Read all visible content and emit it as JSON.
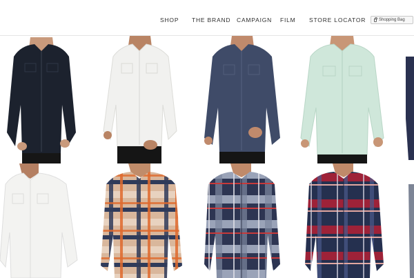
{
  "header": {
    "nav": [
      "SHOP",
      "THE BRAND",
      "CAMPAIGN",
      "FILM",
      "STORE LOCATOR"
    ],
    "bag_label": "Shopping Bag"
  },
  "colors": {
    "nav_text": "#2e2e2e",
    "background": "#ffffff"
  },
  "products": [
    {
      "style": "navy solid denim western shirt",
      "color": "#1c222e"
    },
    {
      "style": "white solid western shirt",
      "color": "#f1f1ef"
    },
    {
      "style": "slate blue solid western shirt",
      "color": "#3f4b68"
    },
    {
      "style": "mint solid western shirt",
      "color": "#cfe7da"
    },
    {
      "style": "white solid shirt",
      "color": "#f3f3f1"
    },
    {
      "style": "tan orange navy plaid shirt",
      "color": "#c89a7a"
    },
    {
      "style": "navy grey red plaid shirt",
      "color": "#2d3552"
    },
    {
      "style": "navy burgundy plaid shirt",
      "color": "#25304f"
    }
  ]
}
